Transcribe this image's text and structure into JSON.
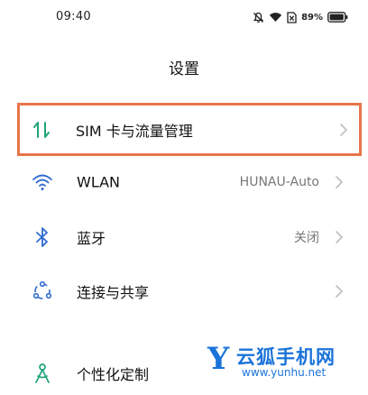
{
  "status_bar": {
    "time": "09:40",
    "battery_percent": "89%",
    "icons": [
      "mute-bell-icon",
      "wifi-icon",
      "sim-x-icon",
      "battery-icon"
    ]
  },
  "page": {
    "title": "设置"
  },
  "settings": {
    "items": [
      {
        "label": "SIM 卡与流量管理",
        "value": "",
        "icon": "sim-data-icon"
      },
      {
        "label": "WLAN",
        "value": "HUNAU-Auto",
        "icon": "wifi-icon"
      },
      {
        "label": "蓝牙",
        "value": "关闭",
        "icon": "bluetooth-icon"
      },
      {
        "label": "连接与共享",
        "value": "",
        "icon": "connection-share-icon"
      },
      {
        "label": "个性化定制",
        "value": "",
        "icon": "personalization-icon"
      }
    ]
  },
  "watermark": {
    "letter": "Y",
    "name": "云狐手机网",
    "url": "www.yunhu.net"
  },
  "colors": {
    "highlight_border": "#e8754a",
    "icon_teal": "#1fa37a",
    "icon_blue": "#2f6ad0",
    "watermark_blue": "#1a73d9"
  }
}
